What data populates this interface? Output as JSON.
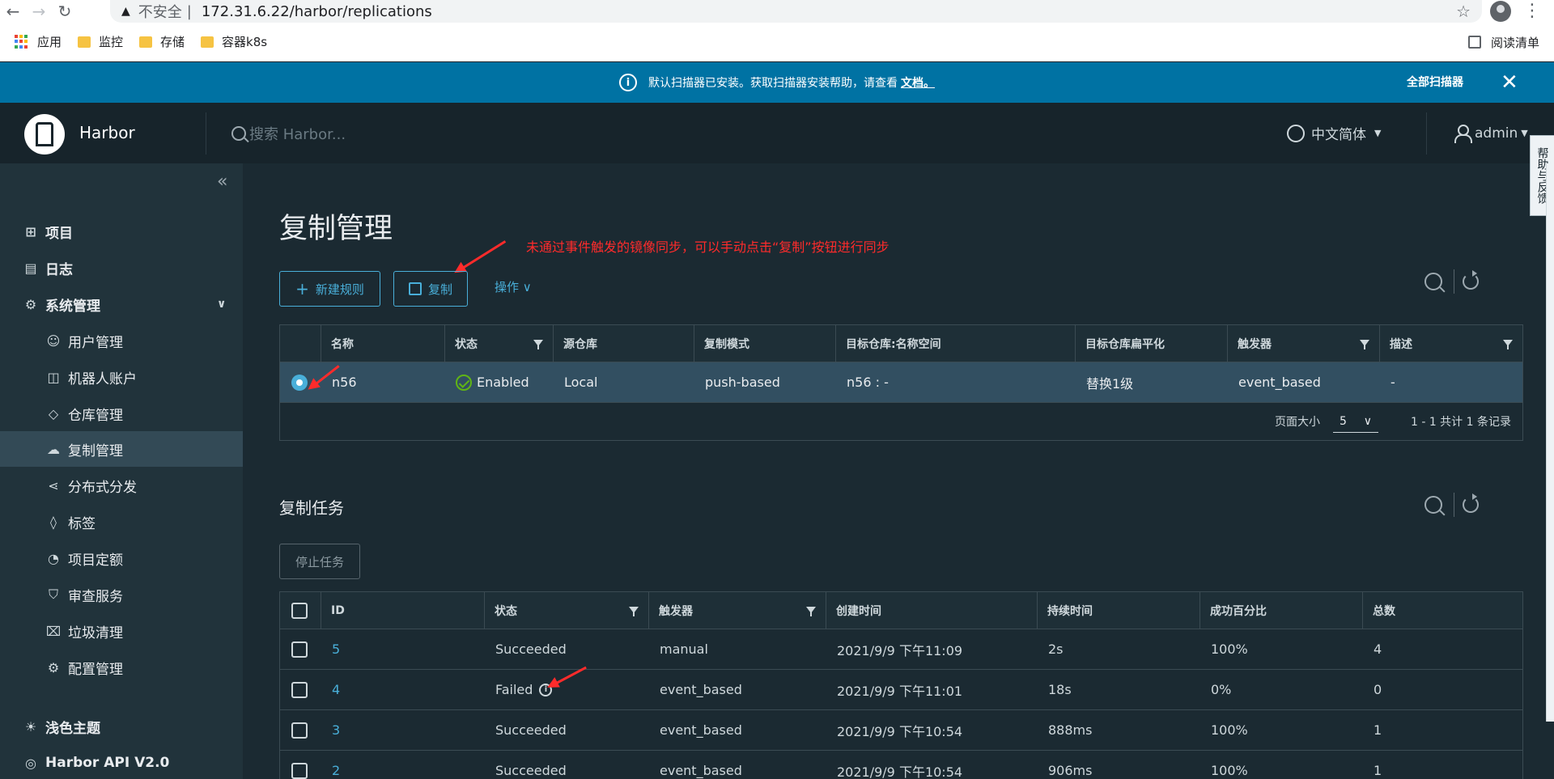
{
  "browser": {
    "insecure_label": "不安全",
    "url": "172.31.6.22/harbor/replications",
    "bookmarks": [
      "应用",
      "监控",
      "存储",
      "容器k8s"
    ],
    "reading_list": "阅读清单"
  },
  "banner": {
    "message": "默认扫描器已安装。获取扫描器安装帮助，请查看",
    "link_text": "文档。",
    "scan_all": "全部扫描器"
  },
  "header": {
    "brand": "Harbor",
    "search_placeholder": "搜索 Harbor...",
    "language": "中文简体",
    "user": "admin",
    "side_tab": "帮助与反馈"
  },
  "sidebar": {
    "items": [
      {
        "label": "项目",
        "icon": "projects-icon"
      },
      {
        "label": "日志",
        "icon": "logs-icon"
      },
      {
        "label": "系统管理",
        "icon": "admin-icon"
      },
      {
        "label": "用户管理",
        "icon": "users-icon"
      },
      {
        "label": "机器人账户",
        "icon": "robot-icon"
      },
      {
        "label": "仓库管理",
        "icon": "registry-icon"
      },
      {
        "label": "复制管理",
        "icon": "replication-icon"
      },
      {
        "label": "分布式分发",
        "icon": "distribution-icon"
      },
      {
        "label": "标签",
        "icon": "tag-icon"
      },
      {
        "label": "项目定额",
        "icon": "quota-icon"
      },
      {
        "label": "审查服务",
        "icon": "shield-icon"
      },
      {
        "label": "垃圾清理",
        "icon": "trash-icon"
      },
      {
        "label": "配置管理",
        "icon": "gear-icon"
      },
      {
        "label": "浅色主题",
        "icon": "sun-icon"
      },
      {
        "label": "Harbor API V2.0",
        "icon": "api-icon"
      }
    ]
  },
  "main": {
    "title": "复制管理",
    "annotation": "未通过事件触发的镜像同步，可以手动点击“复制”按钮进行同步",
    "new_rule": "新建规则",
    "replicate": "复制",
    "actions": "操作",
    "rules_table": {
      "headers": [
        "名称",
        "状态",
        "源仓库",
        "复制模式",
        "目标仓库:名称空间",
        "目标仓库扁平化",
        "触发器",
        "描述"
      ],
      "rows": [
        {
          "name": "n56",
          "status": "Enabled",
          "source": "Local",
          "mode": "push-based",
          "target": "n56 : -",
          "flatten": "替换1级",
          "trigger": "event_based",
          "desc": "-"
        }
      ],
      "page_size_label": "页面大小",
      "page_size": "5",
      "pagination": "1 - 1 共计 1 条记录"
    },
    "tasks_title": "复制任务",
    "stop_task": "停止任务",
    "tasks_table": {
      "headers": [
        "ID",
        "状态",
        "触发器",
        "创建时间",
        "持续时间",
        "成功百分比",
        "总数"
      ],
      "rows": [
        {
          "id": "5",
          "status": "Succeeded",
          "trigger": "manual",
          "created": "2021/9/9 下午11:09",
          "duration": "2s",
          "success": "100%",
          "total": "4"
        },
        {
          "id": "4",
          "status": "Failed",
          "trigger": "event_based",
          "created": "2021/9/9 下午11:01",
          "duration": "18s",
          "success": "0%",
          "total": "0"
        },
        {
          "id": "3",
          "status": "Succeeded",
          "trigger": "event_based",
          "created": "2021/9/9 下午10:54",
          "duration": "888ms",
          "success": "100%",
          "total": "1"
        },
        {
          "id": "2",
          "status": "Succeeded",
          "trigger": "event_based",
          "created": "2021/9/9 下午10:54",
          "duration": "906ms",
          "success": "100%",
          "total": "1"
        }
      ]
    }
  },
  "colors": {
    "accent": "#49afd9",
    "banner": "#0072a3",
    "success": "#60b515",
    "annotation": "#ff2b2b"
  }
}
